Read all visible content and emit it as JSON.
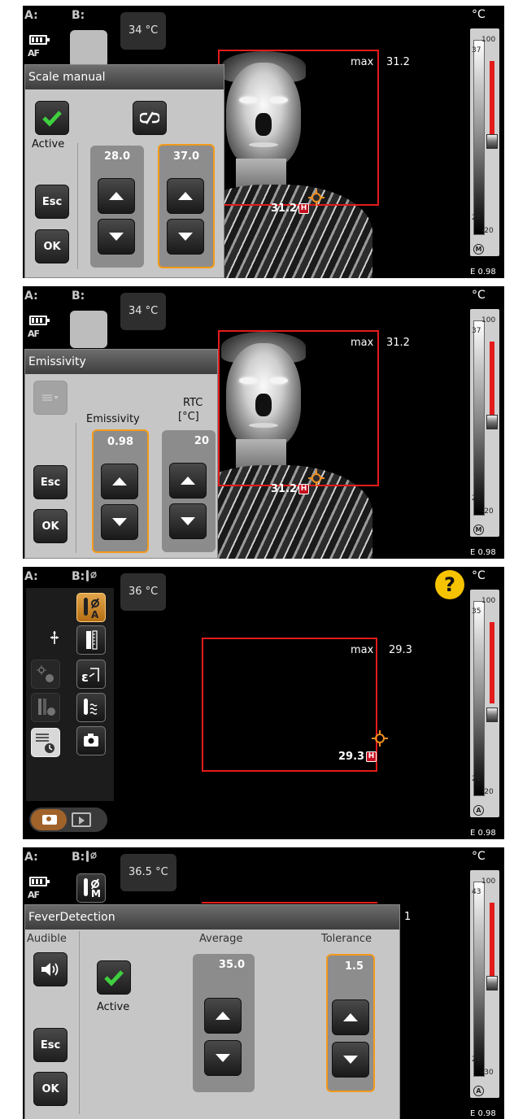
{
  "common": {
    "a_label": "A:",
    "b_label": "B:",
    "unit": "°C",
    "max_label": "max",
    "h_marker": "H"
  },
  "screen1": {
    "temp_chip": "34 °C",
    "max_value": "31.2",
    "h_value": "31.2",
    "dialog_title": "Scale manual",
    "active_label": "Active",
    "esc_label": "Esc",
    "ok_label": "OK",
    "col1_value": "28.0",
    "col2_value": "37.0",
    "scale_top": "100",
    "scale_upper": "37",
    "scale_lower": "28",
    "scale_bottom": "-20",
    "mode_letter": "M",
    "emissivity": "E 0.98"
  },
  "screen2": {
    "temp_chip": "34 °C",
    "max_value": "31.2",
    "h_value": "31.2",
    "dialog_title": "Emissivity",
    "emissivity_label": "Emissivity",
    "rtc_label_line1": "RTC",
    "rtc_label_line2": "[°C]",
    "emissivity_value": "0.98",
    "rtc_value": "20",
    "esc_label": "Esc",
    "ok_label": "OK",
    "scale_top": "100",
    "scale_upper": "37",
    "scale_lower": "28",
    "scale_bottom": "-20",
    "mode_letter": "M",
    "emissivity": "E 0.98"
  },
  "screen3": {
    "temp_chip": "36 °C",
    "max_value": "29.3",
    "h_value": "29.3",
    "help_glyph": "?",
    "scale_top": "100",
    "scale_upper": "35",
    "scale_lower": "21",
    "scale_bottom": "-20",
    "mode_letter": "A",
    "emissivity": "E 0.98",
    "selected_tool_letter": "A",
    "menu_icons": [
      "spot-measure-icon",
      "scale-icon",
      "emissivity-icon",
      "humidity-icon",
      "camera-icon",
      "move-icon",
      "hotspot-icon",
      "coldspot-icon",
      "settings-icon"
    ]
  },
  "screen4": {
    "temp_chip": "36.5 °C",
    "tool_letter": "M",
    "dialog_title": "FeverDetection",
    "audible_label": "Audible",
    "active_label": "Active",
    "average_label": "Average",
    "tolerance_label": "Tolerance",
    "average_value": "35.0",
    "tolerance_value": "1.5",
    "esc_label": "Esc",
    "ok_label": "OK",
    "max_value_fragment": "1",
    "scale_top": "100",
    "scale_upper": "43",
    "scale_lower": "22",
    "scale_bottom": "-30",
    "mode_letter": "A",
    "emissivity": "E 0.98"
  }
}
